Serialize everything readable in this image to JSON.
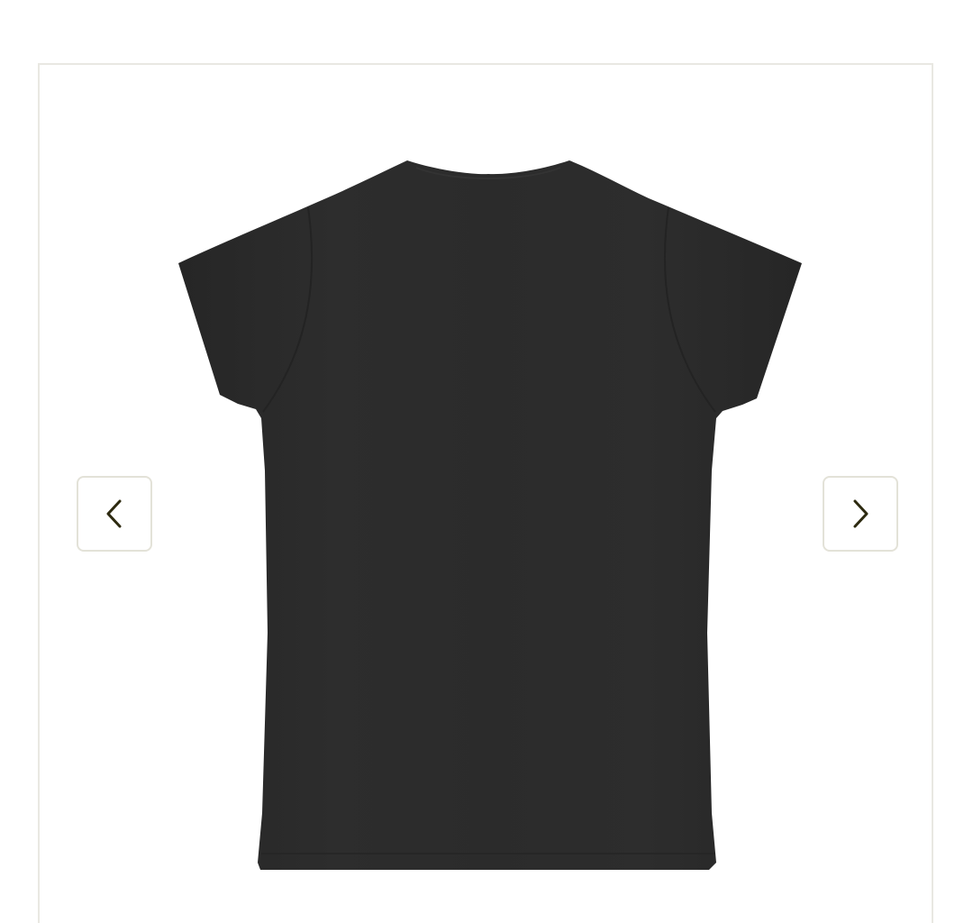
{
  "gallery": {
    "image": {
      "subject": "tshirt-back-image",
      "garment_color": "#2b2b2b"
    },
    "controls": {
      "prev_icon": "chevron-left-icon",
      "next_icon": "chevron-right-icon",
      "icon_color": "#2d2a10",
      "border_color": "#e3e2d8"
    },
    "frame_border_color": "#e9e8e2"
  }
}
